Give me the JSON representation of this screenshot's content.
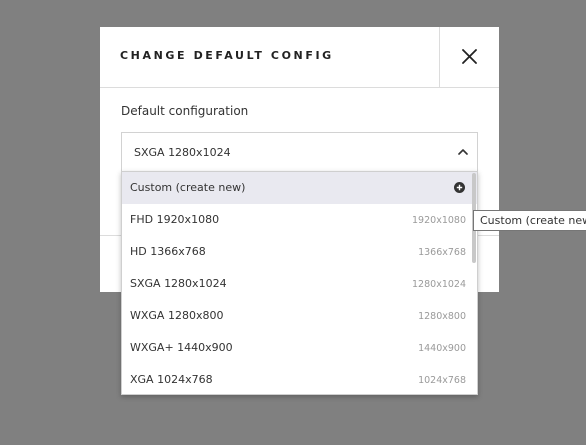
{
  "modal": {
    "title": "CHANGE DEFAULT CONFIG",
    "close_icon": "close-icon",
    "field_label": "Default configuration",
    "select": {
      "value": "SXGA 1280x1024",
      "chevron_icon": "chevron-up-icon",
      "expanded": true
    }
  },
  "dropdown": {
    "options": [
      {
        "label": "Custom (create new)",
        "hint": "",
        "icon": "plus-circle-icon",
        "highlighted": true
      },
      {
        "label": "FHD 1920x1080",
        "hint": "1920x1080"
      },
      {
        "label": "HD 1366x768",
        "hint": "1366x768"
      },
      {
        "label": "SXGA 1280x1024",
        "hint": "1280x1024"
      },
      {
        "label": "WXGA 1280x800",
        "hint": "1280x800"
      },
      {
        "label": "WXGA+ 1440x900",
        "hint": "1440x900"
      },
      {
        "label": "XGA 1024x768",
        "hint": "1024x768"
      }
    ]
  },
  "tooltip": {
    "text": "Custom (create new)"
  },
  "colors": {
    "backdrop": "#808080",
    "highlight": "#e9e9f0",
    "hint_text": "#9a9a9a"
  }
}
